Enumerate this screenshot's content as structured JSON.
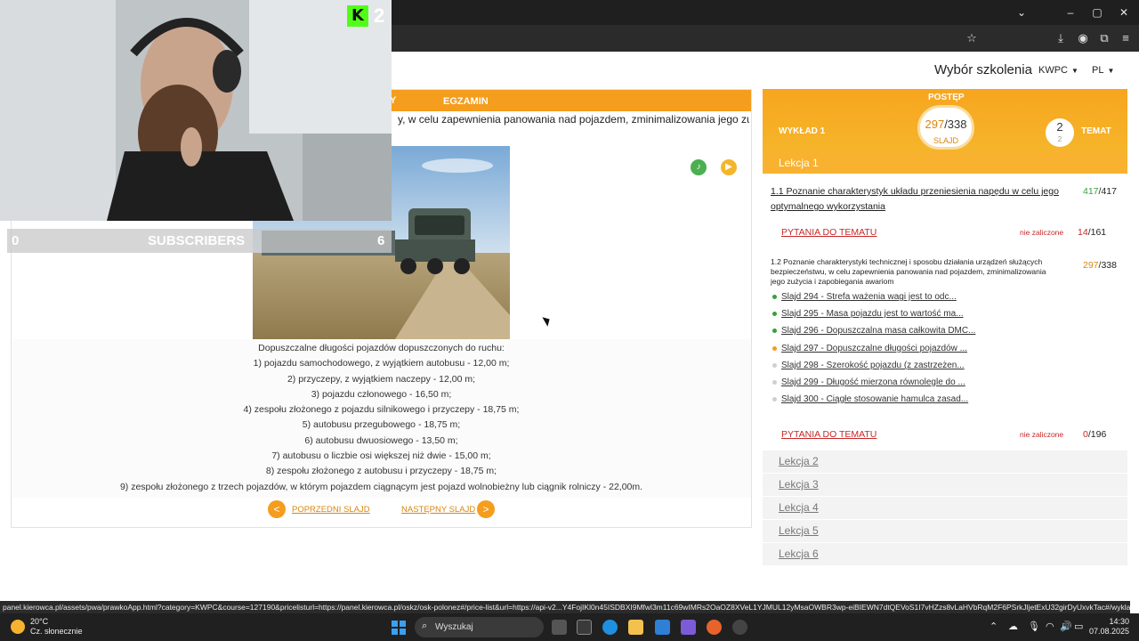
{
  "page": {
    "title": "Wybór szkolenia",
    "course": "KWPC",
    "language": "PL"
  },
  "tabs": {
    "partial_tab": "Y",
    "exam_tab": "EGZAMIN"
  },
  "slide": {
    "title_fragment": "y, w celu zapewnienia panowania nad pojazdem, zminimalizowania jego zużycia i",
    "text_lines": [
      "Dopuszczalne długości pojazdów dopuszczonych do ruchu:",
      "1) pojazdu samochodowego, z wyjątkiem autobusu - 12,00 m;",
      "2) przyczepy, z wyjątkiem naczepy - 12,00 m;",
      "3) pojazdu członowego - 16,50 m;",
      "4) zespołu złożonego z pojazdu silnikowego i przyczepy - 18,75 m;",
      "5) autobusu przegubowego - 18,75 m;",
      "6) autobusu dwuosiowego - 13,50 m;",
      "7) autobusu o liczbie osi większej niż dwie - 15,00 m;",
      "8) zespołu złożonego z autobusu i przyczepy - 18,75 m;",
      "9) zespołu złożonego z trzech pojazdów, w którym pojazdem ciągnącym jest pojazd wolnobieżny lub ciągnik rolniczy - 22,00m."
    ],
    "prev_label": "POPRZEDNI SLAJD",
    "next_label": "NASTĘPNY SLAJD",
    "prev_icon": "<",
    "next_icon": ">"
  },
  "progress": {
    "label": "POSTĘP",
    "current": "297",
    "total": "/338",
    "unit": "SLAJD",
    "lecture": "WYKŁAD 1",
    "topic_num": "2",
    "topic_sub": "2",
    "topic_label": "TEMAT"
  },
  "lesson1": {
    "label": "Lekcja 1",
    "topic1": {
      "title_line1": "1.1 Poznanie charakterystyk układu przeniesienia napędu w celu jego",
      "title_line2": "optymalnego wykorzystania",
      "done": "417",
      "total": "/417"
    },
    "questions1": {
      "label": "PYTANIA DO TEMATU",
      "status": "nie zaliczone",
      "done": "14",
      "total": "/161"
    },
    "topic2": {
      "title_line1": "1.2 Poznanie charakterystyki technicznej i sposobu działania urządzeń służących",
      "title_line2": "bezpieczeństwu, w celu zapewnienia panowania nad pojazdem, zminimalizowania",
      "title_line3": "jego zużycia i zapobiegania awariom",
      "done": "297",
      "total": "/338"
    },
    "slides": [
      {
        "label": "Slajd 294 - Strefa ważenia wagi jest to odc...",
        "status": "done"
      },
      {
        "label": "Slajd 295 - Masa pojazdu jest to wartość ma...",
        "status": "done"
      },
      {
        "label": "Slajd 296 - Dopuszczalna masa całkowita DMC...",
        "status": "done"
      },
      {
        "label": "Slajd 297 - Dopuszczalne długości pojazdów ...",
        "status": "current"
      },
      {
        "label": "Slajd 298 - Szerokość pojazdu (z zastrzeżen...",
        "status": "todo"
      },
      {
        "label": "Slajd 299 - Długość mierzona równolegle do ...",
        "status": "todo"
      },
      {
        "label": "Slajd 300 - Ciągłe stosowanie hamulca zasad...",
        "status": "todo"
      }
    ],
    "questions2": {
      "label": "PYTANIA DO TEMATU",
      "status": "nie zaliczone",
      "done": "0",
      "total": "/196"
    }
  },
  "lessons": [
    "Lekcja 2",
    "Lekcja 3",
    "Lekcja 4",
    "Lekcja 5",
    "Lekcja 6"
  ],
  "statusbar": {
    "url": "panel.kierowca.pl/assets/pwa/prawkoApp.html?category=KWPC&course=127190&pricelisturl=https://panel.kierowca.pl/oskz/osk-polonez#/price-list&url=https://api-v2...Y4FojIKl0n45ISDBXI9Mfwl3m11c69wIMRs2OaOZ8XVeL1YJMUL12yMsaOWBR3wp-eiBIEWN7dtQEVoS1I7vHZzs8vLaHVbRqM2F6PSrkJljetExU32girDyUxvkTac#/wyklady/lekcja-124/234/84466"
  },
  "taskbar": {
    "temperature": "20°C",
    "condition": "Cz. słonecznie",
    "search": "Wyszukaj",
    "time": "14:30",
    "date": "07.08.2025"
  },
  "overlay": {
    "kick_letter": "K",
    "kick_count": "2",
    "sub_left": "0",
    "sub_label": "SUBSCRIBERS",
    "sub_right": "6"
  },
  "colors": {
    "accent": "#f59d1d",
    "done": "#36a13b",
    "fail": "#c62828"
  }
}
